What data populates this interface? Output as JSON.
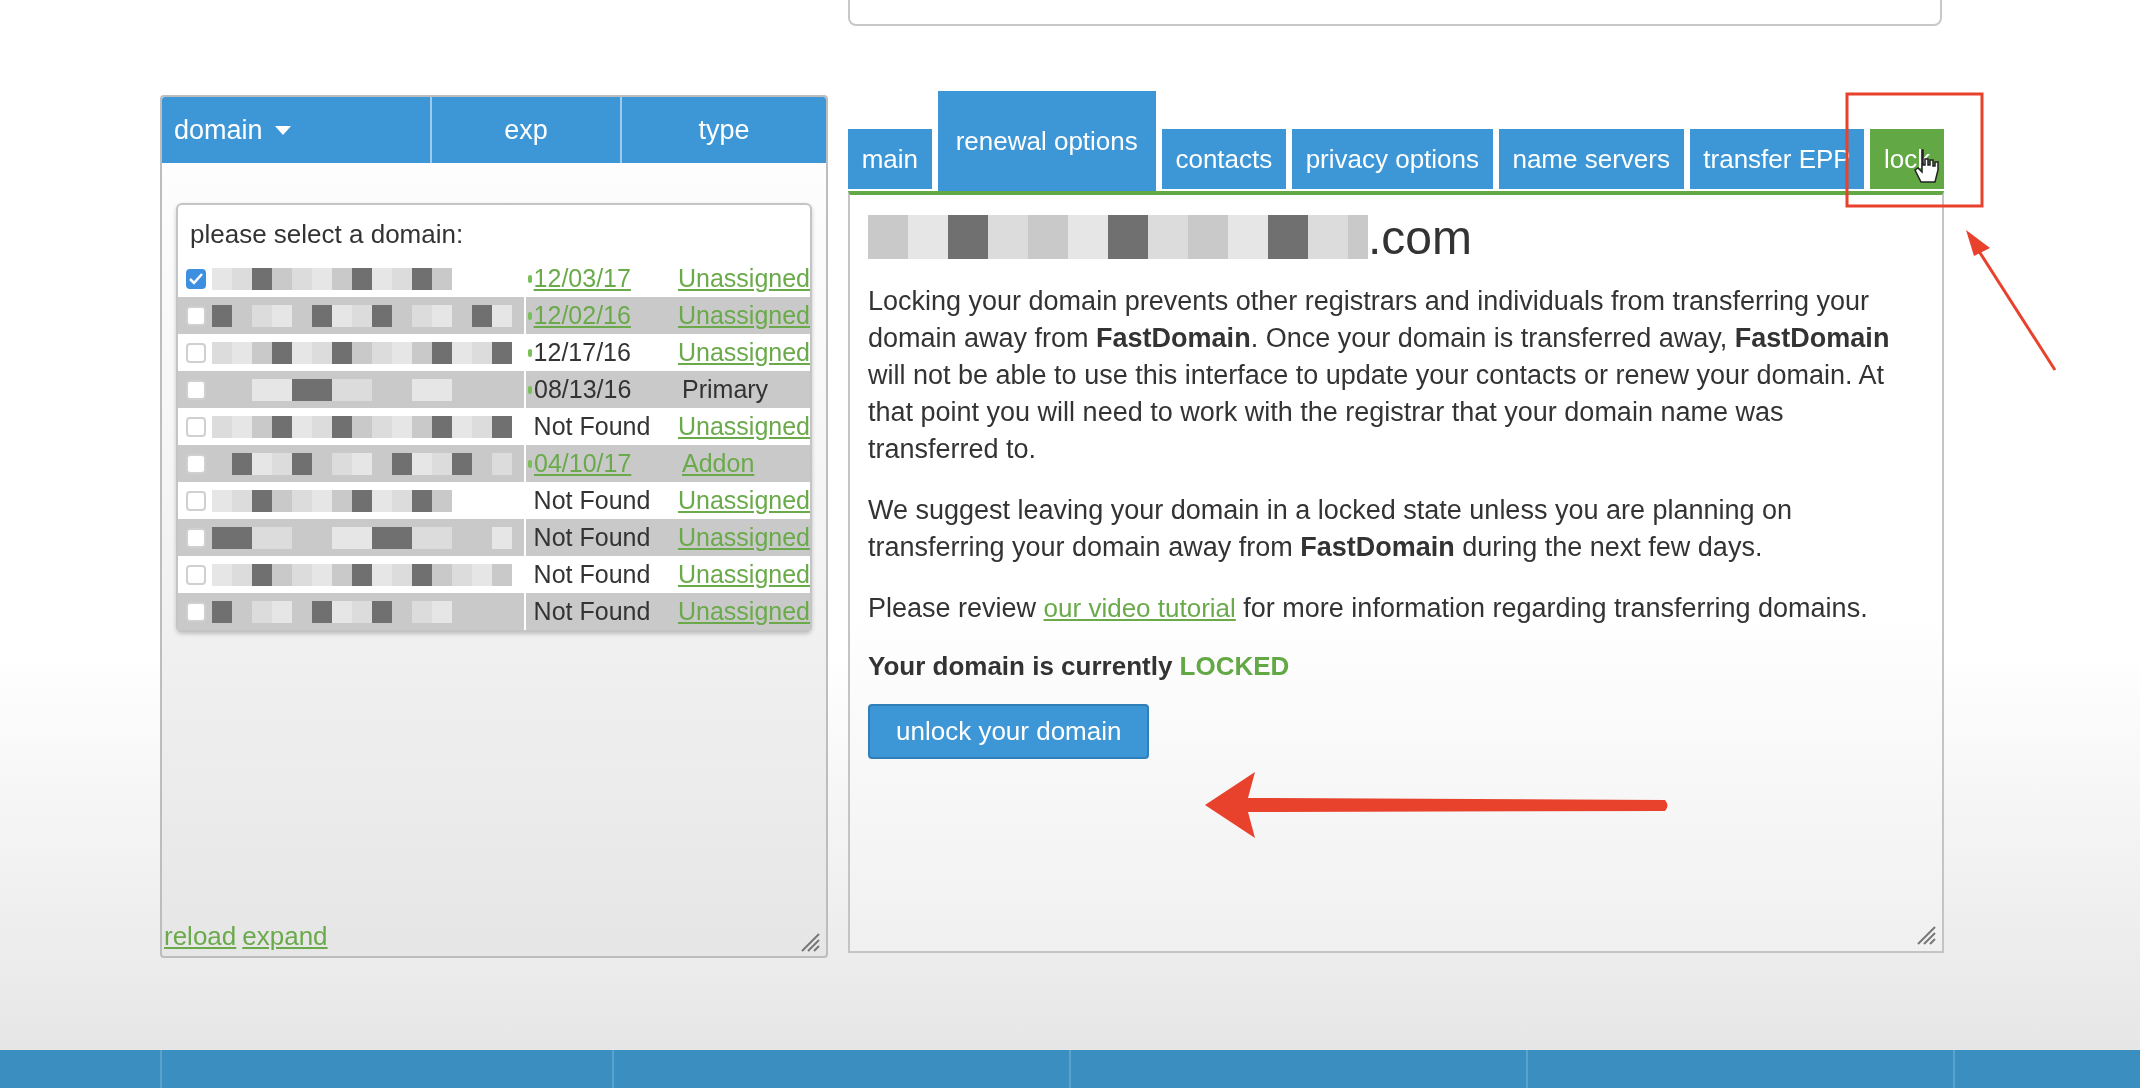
{
  "domain_panel": {
    "columns": [
      {
        "label": "domain",
        "sortable": true
      },
      {
        "label": "exp",
        "sortable": false
      },
      {
        "label": "type",
        "sortable": false
      }
    ],
    "prompt": "please select a domain:",
    "rows": [
      {
        "checked": true,
        "indicator": true,
        "exp": "12/03/17",
        "exp_linked": true,
        "type": "Unassigned",
        "type_linked": true
      },
      {
        "checked": false,
        "indicator": true,
        "exp": "12/02/16",
        "exp_linked": true,
        "type": "Unassigned",
        "type_linked": true
      },
      {
        "checked": false,
        "indicator": true,
        "exp": "12/17/16",
        "exp_linked": false,
        "type": "Unassigned",
        "type_linked": true
      },
      {
        "checked": false,
        "indicator": true,
        "exp": "08/13/16",
        "exp_linked": false,
        "type": "Primary",
        "type_linked": false
      },
      {
        "checked": false,
        "indicator": false,
        "exp": "Not Found",
        "exp_linked": false,
        "type": "Unassigned",
        "type_linked": true
      },
      {
        "checked": false,
        "indicator": true,
        "exp": "04/10/17",
        "exp_linked": true,
        "type": "Addon",
        "type_linked": true
      },
      {
        "checked": false,
        "indicator": false,
        "exp": "Not Found",
        "exp_linked": false,
        "type": "Unassigned",
        "type_linked": true
      },
      {
        "checked": false,
        "indicator": false,
        "exp": "Not Found",
        "exp_linked": false,
        "type": "Unassigned",
        "type_linked": true
      },
      {
        "checked": false,
        "indicator": false,
        "exp": "Not Found",
        "exp_linked": false,
        "type": "Unassigned",
        "type_linked": true
      },
      {
        "checked": false,
        "indicator": false,
        "exp": "Not Found",
        "exp_linked": false,
        "type": "Unassigned",
        "type_linked": true
      }
    ],
    "footer_links": [
      "reload",
      "expand"
    ]
  },
  "tabs": [
    {
      "label": "main",
      "selected": false,
      "raised": false
    },
    {
      "label": "renewal options",
      "selected": false,
      "raised": true
    },
    {
      "label": "contacts",
      "selected": false,
      "raised": false
    },
    {
      "label": "privacy options",
      "selected": false,
      "raised": false
    },
    {
      "label": "name servers",
      "selected": false,
      "raised": false
    },
    {
      "label": "transfer EPP",
      "selected": false,
      "raised": false
    },
    {
      "label": "lock",
      "selected": true,
      "raised": false
    }
  ],
  "lock_panel": {
    "domain_suffix": ".com",
    "paragraphs": [
      {
        "text": "Locking your domain prevents other registrars and individuals from transferring your domain away from **FastDomain**. Once your domain is transferred away, **FastDomain** will not be able to use this interface to update your contacts or renew your domain. At that point you will need to work with the registrar that your domain name was transferred to."
      },
      {
        "text": "We suggest leaving your domain in a locked state unless you are planning on transferring your domain away from **FastDomain** during the next few days."
      },
      {
        "text": "Please review",
        "link": "our video tutorial",
        "after": "for more information regarding transferring domains."
      }
    ],
    "status": {
      "label": "Your domain is currently",
      "value": "LOCKED",
      "locked": true
    },
    "button": "unlock your domain"
  }
}
